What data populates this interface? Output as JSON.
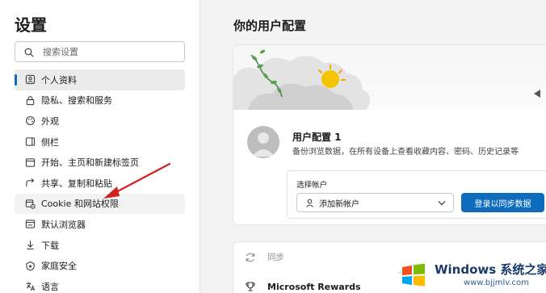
{
  "sidebar": {
    "title": "设置",
    "search": {
      "placeholder": "搜索设置"
    },
    "items": [
      {
        "label": "个人资料",
        "icon": "profile-icon",
        "active": true
      },
      {
        "label": "隐私、搜索和服务",
        "icon": "lock-icon"
      },
      {
        "label": "外观",
        "icon": "appearance-icon"
      },
      {
        "label": "侧栏",
        "icon": "sidebar-icon"
      },
      {
        "label": "开始、主页和新建标签页",
        "icon": "home-icon"
      },
      {
        "label": "共享、复制和粘贴",
        "icon": "share-icon"
      },
      {
        "label": "Cookie 和网站权限",
        "icon": "cookie-icon",
        "hover": true
      },
      {
        "label": "默认浏览器",
        "icon": "browser-icon"
      },
      {
        "label": "下载",
        "icon": "download-icon"
      },
      {
        "label": "家庭安全",
        "icon": "family-icon"
      },
      {
        "label": "语言",
        "icon": "language-icon"
      }
    ]
  },
  "main": {
    "title": "你的用户配置",
    "profile": {
      "name": "用户配置 1",
      "description": "备份浏览数据，在所有设备上查看收藏内容、密码、历史记录等"
    },
    "account": {
      "label": "选择帐户",
      "selected": "添加新帐户",
      "sync_button": "登录以同步数据"
    },
    "rows": [
      {
        "label": "同步",
        "icon": "sync-icon"
      },
      {
        "label": "Microsoft Rewards",
        "icon": "trophy-icon"
      }
    ]
  },
  "watermark": {
    "title": "Windows 系统之家",
    "url": "www.bjjmlv.com",
    "logo": "windows-logo"
  },
  "colors": {
    "accent": "#0f6cbd",
    "arrow": "#d32020"
  }
}
